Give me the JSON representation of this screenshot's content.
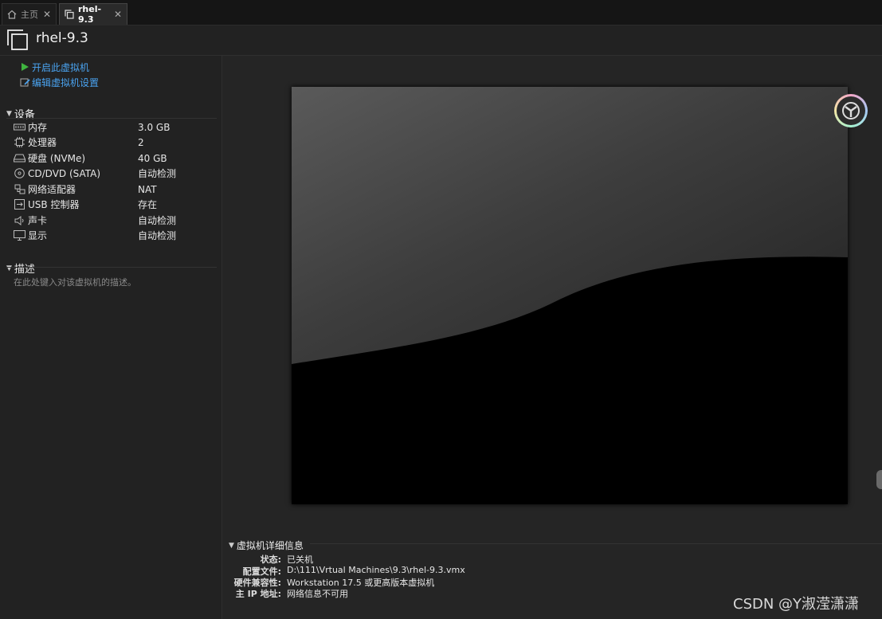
{
  "tabs": [
    {
      "label": "主页",
      "icon": "home-icon"
    },
    {
      "label": "rhel-9.3",
      "icon": "vm-icon"
    }
  ],
  "header": {
    "title": "rhel-9.3"
  },
  "actions": {
    "power_on": "开启此虚拟机",
    "edit_settings": "编辑虚拟机设置"
  },
  "devices": {
    "heading": "设备",
    "items": [
      {
        "icon": "memory-icon",
        "name": "内存",
        "value": "3.0 GB"
      },
      {
        "icon": "processor-icon",
        "name": "处理器",
        "value": "2"
      },
      {
        "icon": "hard-disk-icon",
        "name": "硬盘 (NVMe)",
        "value": "40 GB"
      },
      {
        "icon": "cd-dvd-icon",
        "name": "CD/DVD (SATA)",
        "value": "自动检测"
      },
      {
        "icon": "network-adapter-icon",
        "name": "网络适配器",
        "value": "NAT"
      },
      {
        "icon": "usb-icon",
        "name": "USB 控制器",
        "value": "存在"
      },
      {
        "icon": "sound-card-icon",
        "name": "声卡",
        "value": "自动检测"
      },
      {
        "icon": "display-icon",
        "name": "显示",
        "value": "自动检测"
      }
    ]
  },
  "description": {
    "heading": "描述",
    "placeholder": "在此处键入对该虚拟机的描述。"
  },
  "details": {
    "heading": "虚拟机详细信息",
    "rows": [
      {
        "key": "状态:",
        "value": "已关机"
      },
      {
        "key": "配置文件:",
        "value": "D:\\111\\Vrtual Machines\\9.3\\rhel-9.3.vmx"
      },
      {
        "key": "硬件兼容性:",
        "value": "Workstation 17.5 或更高版本虚拟机"
      },
      {
        "key": "主 IP 地址:",
        "value": "网络信息不可用"
      }
    ]
  },
  "watermark": "CSDN @Y淑滢潇潇",
  "colors": {
    "link": "#4aa3f0",
    "play": "#3fb43f",
    "background": "#202020"
  }
}
